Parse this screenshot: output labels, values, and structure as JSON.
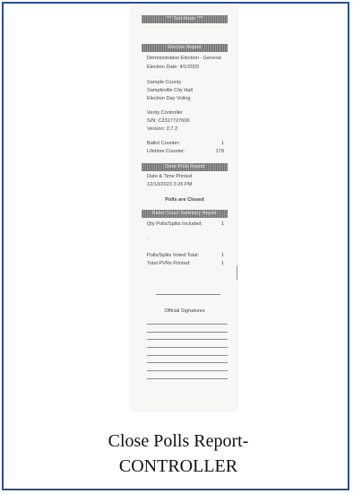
{
  "receipt": {
    "test_mode": "*** Test Mode ***",
    "election_report": "Election Report",
    "election_name": "Demonstration Election - General",
    "election_date": "Election Date: 4/1/2020",
    "county": "Sample County",
    "location": "Sampleville City Hall",
    "voting_type": "Election Day Voting",
    "device_name": "Verity Controller",
    "serial": "S/N: C2317727606",
    "version": "Version: 2.7.2",
    "ballot_counter_label": "Ballot Counter:",
    "ballot_counter_value": "1",
    "lifetime_counter_label": "Lifetime Counter:",
    "lifetime_counter_value": "179",
    "close_polls_report": "Close Polls Report",
    "date_time_label": "Date & Time Printed",
    "date_time_value": "12/13/2023   3:26 PM",
    "polls_closed": "Polls are Closed",
    "summary_title": "Ballot Count Summary Report",
    "qty_label": "Qty Polls/Splits Included:",
    "qty_value": "1",
    "dot": ".",
    "voted_label": "Polls/Splits Voted Total:",
    "voted_value": "1",
    "printed_label": "Total PVRs Printed:",
    "printed_value": "1",
    "signatures_label": "Official Signatures"
  },
  "caption": {
    "line1": "Close Polls Report-",
    "line2": "CONTROLLER"
  }
}
